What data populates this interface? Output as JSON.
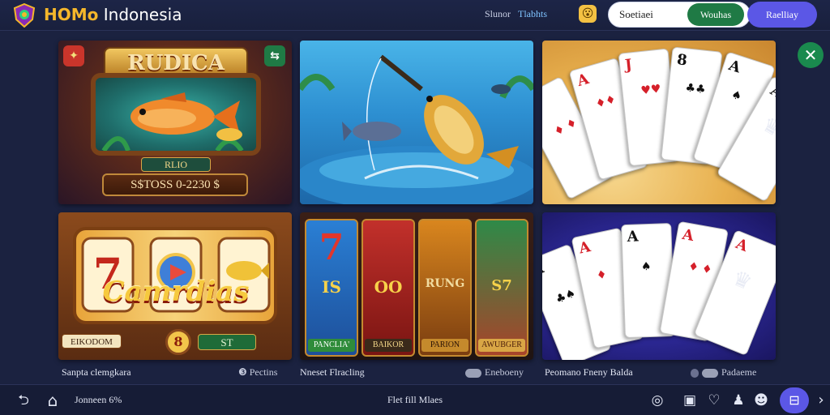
{
  "header": {
    "brand_primary": "HOMo",
    "brand_secondary": "Indonesia",
    "meta_text": "Slunor",
    "meta_highlight": "Tlabhts",
    "emoji": "😮",
    "search_value": "Soetiaei",
    "search_button": "Wouhas",
    "primary_button": "Raelliay"
  },
  "close_icon": "✕",
  "tiles": [
    {
      "banner": "RUDICA",
      "plate_small": "RLIO",
      "plate_big": "S$TOSS 0-2230 $",
      "corner_left": "✦",
      "corner_right": "⇆",
      "caption": "Sanpta clemgkara",
      "caption_right": "❸ Pectins"
    },
    {
      "caption": "Nneset Flracling",
      "caption_right": "Eneboeny"
    },
    {
      "caption": "Peomano Fneny Balda",
      "caption_right": "Padaeme"
    },
    {
      "slot_word": "Camrdias",
      "plate_left": "EIKODOM",
      "plate_right": "ST",
      "coin": "8"
    },
    {
      "reels": [
        {
          "symbol": "7",
          "label": "PANCLIA'"
        },
        {
          "symbol": "OO",
          "label": "BAIKOR"
        },
        {
          "symbol": "RUNG",
          "label": "PARION"
        },
        {
          "symbol": "S7",
          "label": "AWUBGER"
        }
      ],
      "reel_first_mid": "IS"
    },
    {}
  ],
  "bottom": {
    "back_icon": "⮌",
    "home_icon": "⌂",
    "left_text": "Jonneen 6%",
    "center_text": "Flet fill Mlaes",
    "right_icons": [
      "◎",
      "▣",
      "♡",
      "♟",
      "☻"
    ],
    "primary_icon": "⊟",
    "chevron": "›"
  },
  "colors": {
    "background": "#1b2240",
    "accent_green": "#1f7a45",
    "accent_purple": "#5b57e6",
    "brand_gold": "#f5b72b"
  }
}
